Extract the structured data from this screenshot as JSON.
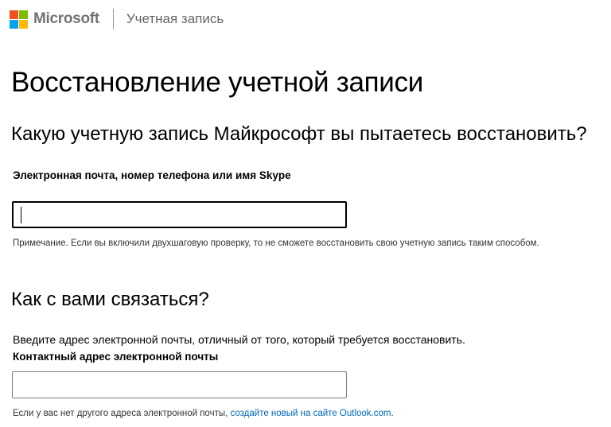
{
  "header": {
    "logo_colors": [
      "#f25022",
      "#7fba00",
      "#00a4ef",
      "#ffb900"
    ],
    "brand": "Microsoft",
    "section": "Учетная запись"
  },
  "main": {
    "title": "Восстановление учетной записи",
    "subtitle": "Какую учетную запись Майкрософт вы пытаетесь восстановить?",
    "account_field": {
      "label": "Электронная почта, номер телефона или имя Skype",
      "value": "",
      "placeholder": ""
    },
    "note": "Примечание. Если вы включили двухшаговую проверку, то не сможете восстановить свою учетную запись таким способом.",
    "contact_section": {
      "heading": "Как с вами связаться?",
      "instruction": "Введите адрес электронной почты, отличный от того, который требуется восстановить.",
      "contact_field": {
        "label": "Контактный адрес электронной почты",
        "value": "",
        "placeholder": ""
      },
      "footer_text": "Если у вас нет другого адреса электронной почты, ",
      "footer_link": "создайте новый на сайте Outlook.com",
      "footer_end": "."
    }
  },
  "colors": {
    "link": "#0067b8",
    "brand_text": "#737373"
  }
}
